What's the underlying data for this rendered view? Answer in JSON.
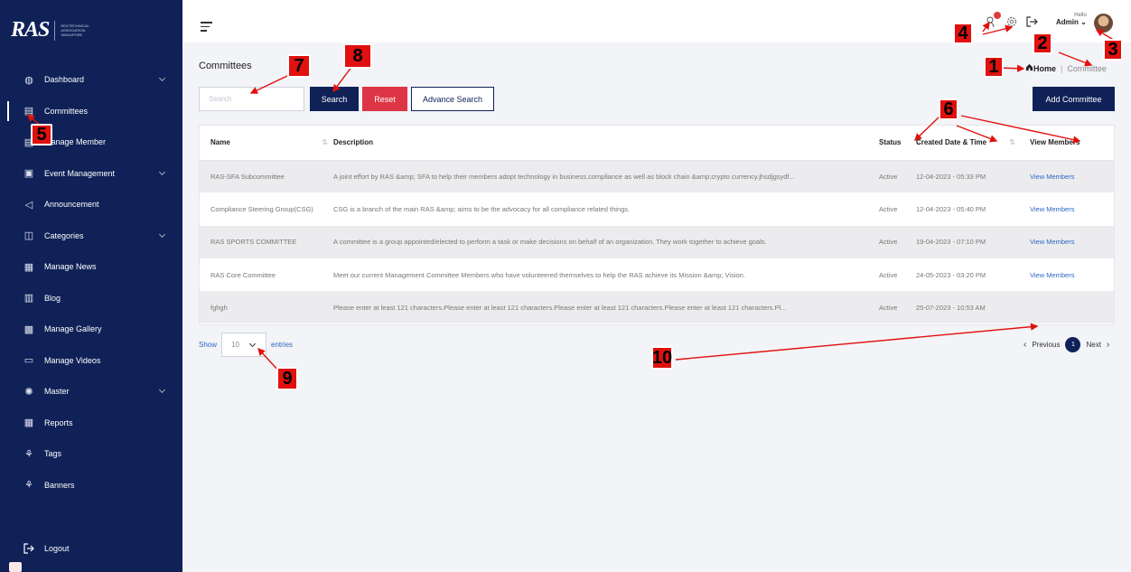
{
  "logo": {
    "mark": "RAS",
    "sub": "REGTECHNICAL ASSOCIATION SINGAPORE"
  },
  "sidebar": {
    "items": [
      {
        "label": "Dashboard",
        "icon": "globe-icon",
        "chevron": true
      },
      {
        "label": "Committees",
        "icon": "committee-icon",
        "chevron": false
      },
      {
        "label": "Manage Member",
        "icon": "member-icon",
        "chevron": false
      },
      {
        "label": "Event Management",
        "icon": "calendar-icon",
        "chevron": true
      },
      {
        "label": "Announcement",
        "icon": "megaphone-icon",
        "chevron": false
      },
      {
        "label": "Categories",
        "icon": "categories-icon",
        "chevron": true
      },
      {
        "label": "Manage News",
        "icon": "news-icon",
        "chevron": false
      },
      {
        "label": "Blog",
        "icon": "blog-icon",
        "chevron": false
      },
      {
        "label": "Manage Gallery",
        "icon": "gallery-icon",
        "chevron": false
      },
      {
        "label": "Manage Videos",
        "icon": "video-icon",
        "chevron": false
      },
      {
        "label": "Master",
        "icon": "master-icon",
        "chevron": true
      },
      {
        "label": "Reports",
        "icon": "reports-icon",
        "chevron": false
      },
      {
        "label": "Tags",
        "icon": "tags-icon",
        "chevron": false
      },
      {
        "label": "Banners",
        "icon": "banners-icon",
        "chevron": false
      }
    ],
    "logout": "Logout"
  },
  "header": {
    "hello": "Hello",
    "user": "Admin"
  },
  "page": {
    "title": "Committees",
    "breadcrumb_home": "Home",
    "breadcrumb_current": "Committee"
  },
  "toolbar": {
    "search_placeholder": "Search",
    "search_label": "Search",
    "reset_label": "Reset",
    "advance_label": "Advance Search",
    "add_label": "Add Committee"
  },
  "table": {
    "headers": [
      "Name",
      "Description",
      "Status",
      "Created Date & Time",
      "View Members"
    ],
    "rows": [
      [
        "RAS-SFA Subcommittee",
        "A joint effort by RAS &amp; SFA to help their members adopt technology in business,compliance as well as block chain &amp;crypto currency.jhsdjgsydf...",
        "Active",
        "12-04-2023 - 05:33 PM",
        "View Members"
      ],
      [
        "Compliance Steering Group(CSG)",
        "CSG is a branch of the main RAS &amp; aims to be the advocacy for all compliance related things.",
        "Active",
        "12-04-2023 - 05:40 PM",
        "View Members"
      ],
      [
        "RAS SPORTS COMMITTEE",
        "A committee is a group appointed/elected to perform a task or make decisions on behalf of an organization. They work together to achieve goals.",
        "Active",
        "19-04-2023 - 07:10 PM",
        "View Members"
      ],
      [
        "RAS Core Committee",
        "Meet our current Management Committee Members who have volunteered themselves to help the RAS achieve its Mission &amp; Vision.",
        "Active",
        "24-05-2023 - 03:20 PM",
        "View Members"
      ],
      [
        "fghgh",
        "Please enter at least 121 characters.Please enter at least 121 characters.Please enter at least 121 characters.Please enter at least 121 characters.Pl...",
        "Active",
        "25-07-2023 - 10:53 AM",
        ""
      ]
    ]
  },
  "footer": {
    "show": "Show",
    "entries_value": "10",
    "entries": "entries",
    "previous": "Previous",
    "page": "1",
    "next": "Next"
  },
  "annotations": [
    "1",
    "2",
    "3",
    "4",
    "5",
    "6",
    "7",
    "8",
    "9",
    "10"
  ],
  "colors": {
    "sidebar": "#0f2157",
    "accent": "#0f2157",
    "reset": "#dd3545",
    "annotation": "#e0110e"
  }
}
